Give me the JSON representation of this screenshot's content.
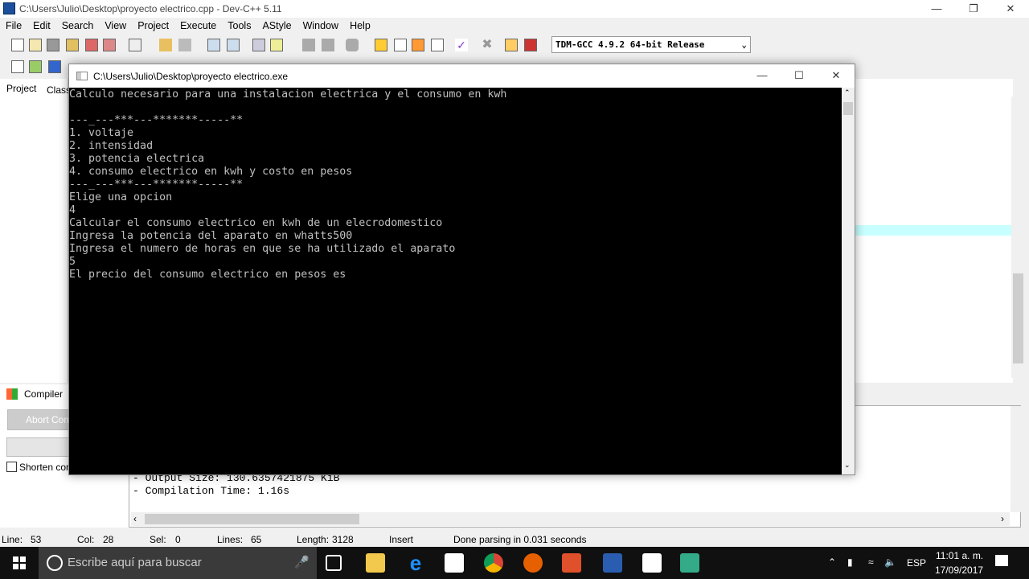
{
  "ide": {
    "title": "C:\\Users\\Julio\\Desktop\\proyecto electrico.cpp - Dev-C++ 5.11",
    "menu": [
      "File",
      "Edit",
      "Search",
      "View",
      "Project",
      "Execute",
      "Tools",
      "AStyle",
      "Window",
      "Help"
    ],
    "compiler_select": "TDM-GCC 4.9.2 64-bit Release",
    "left_tabs": [
      "Project",
      "Classes"
    ],
    "bottom_tab": "Compiler",
    "abort_button": "Abort Compilation",
    "shorten_checkbox": "Shorten compiler paths",
    "output_lines": [
      "- Output Size: 130.6357421875 KiB",
      "- Compilation Time: 1.16s"
    ],
    "status": {
      "line_label": "Line:",
      "line": "53",
      "col_label": "Col:",
      "col": "28",
      "sel_label": "Sel:",
      "sel": "0",
      "lines_label": "Lines:",
      "lines": "65",
      "length_label": "Length:",
      "length": "3128",
      "mode": "Insert",
      "message": "Done parsing in 0.031 seconds"
    }
  },
  "console": {
    "title": "C:\\Users\\Julio\\Desktop\\proyecto electrico.exe",
    "lines": [
      "Calculo necesario para una instalacion electrica y el consumo en kwh",
      "",
      "---_---***---*******-----**",
      "1. voltaje",
      "2. intensidad",
      "3. potencia electrica",
      "4. consumo electrico en kwh y costo en pesos",
      "---_---***---*******-----**",
      "Elige una opcion",
      "4",
      "Calcular el consumo electrico en kwh de un elecrodomestico",
      "Ingresa la potencia del aparato en whatts500",
      "Ingresa el numero de horas en que se ha utilizado el aparato",
      "5",
      "El precio del consumo electrico en pesos es"
    ]
  },
  "taskbar": {
    "search_placeholder": "Escribe aquí para buscar",
    "language": "ESP",
    "time": "11:01 a. m.",
    "date": "17/09/2017"
  }
}
